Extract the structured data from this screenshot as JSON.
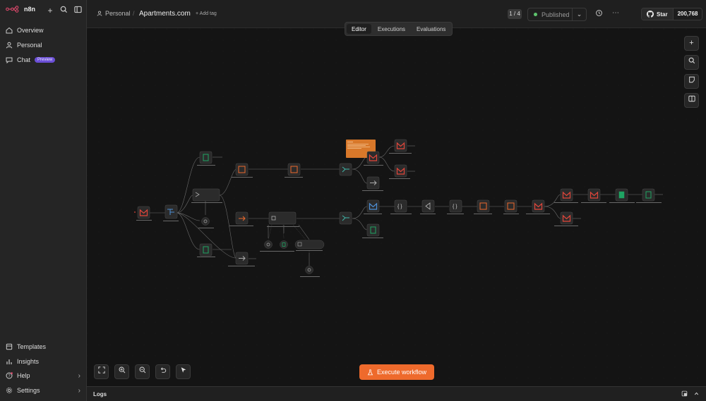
{
  "app": {
    "name": "n8n"
  },
  "sidebar": {
    "items": [
      {
        "label": "Overview",
        "icon": "home-icon"
      },
      {
        "label": "Personal",
        "icon": "user-icon"
      },
      {
        "label": "Chat",
        "icon": "chat-icon",
        "badge": "Preview"
      }
    ],
    "bottom_items": [
      {
        "label": "Templates",
        "icon": "box-icon"
      },
      {
        "label": "Insights",
        "icon": "chart-icon"
      },
      {
        "label": "Help",
        "icon": "help-icon"
      },
      {
        "label": "Settings",
        "icon": "gear-icon"
      }
    ]
  },
  "header": {
    "breadcrumb_project": "Personal",
    "breadcrumb_separator": "/",
    "workflow_title": "Apartments.com",
    "add_tag": "+ Add tag",
    "pager": "1 / 4",
    "publish_status": "Published",
    "github_star": "Star",
    "github_count": "200,768"
  },
  "tabs": [
    {
      "label": "Editor",
      "active": true
    },
    {
      "label": "Executions",
      "active": false
    },
    {
      "label": "Evaluations",
      "active": false
    }
  ],
  "actions": {
    "execute": "Execute workflow"
  },
  "logs": {
    "label": "Logs"
  },
  "colors": {
    "accent": "#ee6a2c",
    "gmail_red": "#e2463b",
    "sheets_green": "#1fa463",
    "node_bg": "#2b2b2b",
    "note_bg": "#d8782a"
  }
}
